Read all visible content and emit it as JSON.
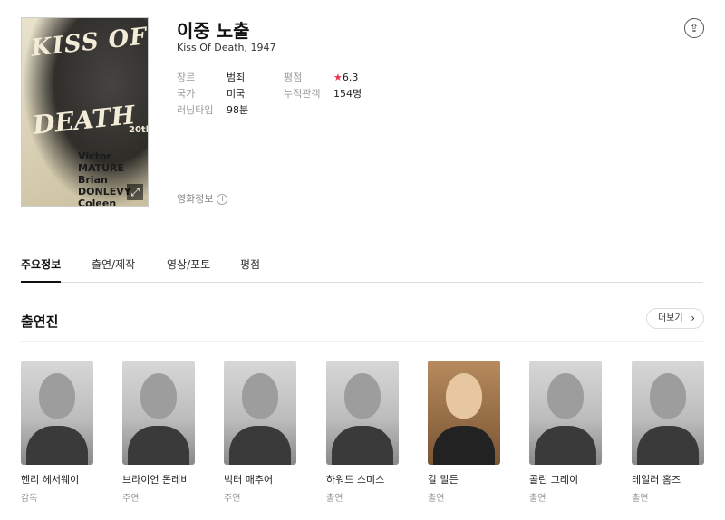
{
  "movie": {
    "title": "이중 노출",
    "original_title": "Kiss Of Death, 1947",
    "poster_text": {
      "title_line1": "KISS OF",
      "title_line2": "DEATH",
      "studio": "20th",
      "cast_lines": [
        "Victor MATURE",
        "Brian DONLEVY",
        "Coleen GRAY"
      ]
    },
    "genre_label": "장르",
    "genre": "범죄",
    "country_label": "국가",
    "country": "미국",
    "runtime_label": "러닝타임",
    "runtime": "98분",
    "rating_label": "평점",
    "rating": "6.3",
    "audience_label": "누적관객",
    "audience": "154명",
    "movie_info_link": "영화정보",
    "info_icon": "i"
  },
  "tabs": [
    "주요정보",
    "출연/제작",
    "영상/포토",
    "평점"
  ],
  "cast_section": {
    "title": "출연진",
    "more_label": "더보기",
    "people": [
      {
        "name": "헨리 헤서웨이",
        "role": "감독"
      },
      {
        "name": "브라이언 돈레비",
        "role": "주연"
      },
      {
        "name": "빅터 매추어",
        "role": "주연"
      },
      {
        "name": "하워드 스미스",
        "role": "출연"
      },
      {
        "name": "칼 말든",
        "role": "출연"
      },
      {
        "name": "콜린 그레이",
        "role": "출연"
      },
      {
        "name": "테일러 홈즈",
        "role": "출연"
      }
    ]
  },
  "icons": {
    "share": "share-icon",
    "expand": "expand-icon",
    "star": "star-icon",
    "chevron": "chevron-right-icon"
  },
  "colors": {
    "rating_star": "#e8344e"
  }
}
